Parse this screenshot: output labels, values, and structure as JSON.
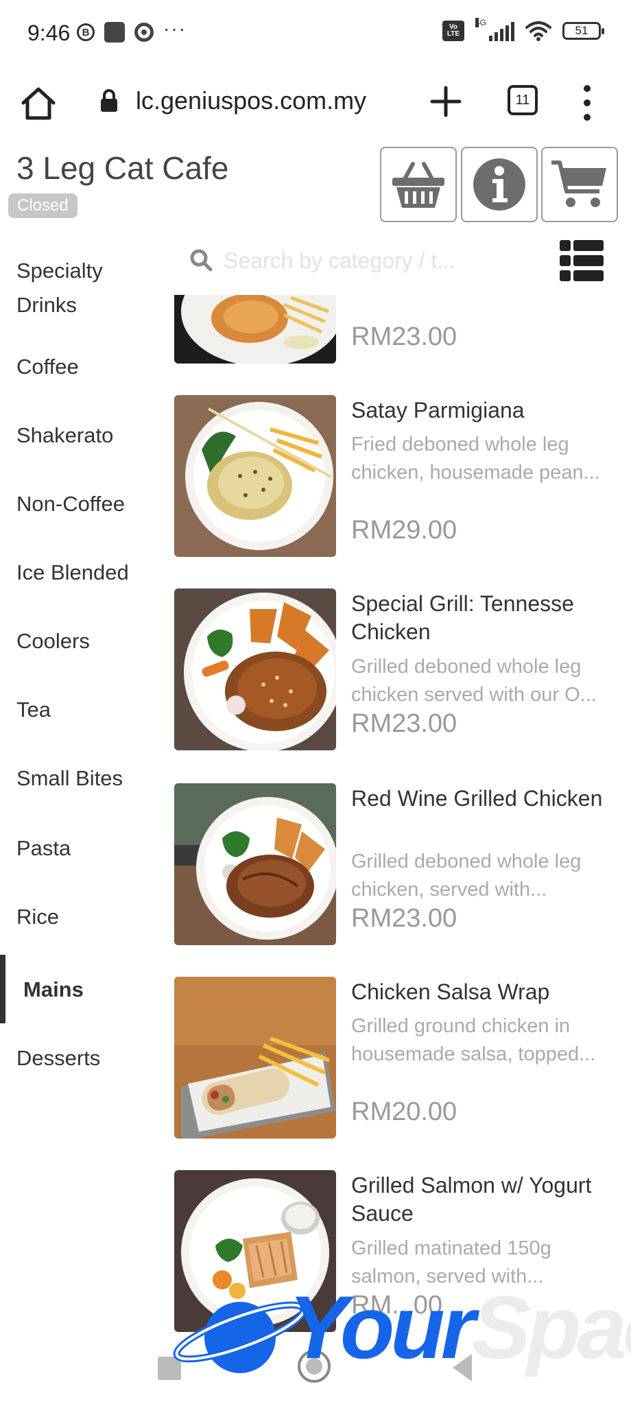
{
  "status_bar": {
    "time": "9:46",
    "b_icon_letter": "B",
    "more": "···",
    "volte": "Vo LTE",
    "network": "4G",
    "battery": "51"
  },
  "browser": {
    "url": "lc.geniuspos.com.my",
    "tab_count": "11"
  },
  "header": {
    "cafe_name": "3 Leg Cat Cafe",
    "status_badge": "Closed"
  },
  "search": {
    "placeholder": "Search by category / t..."
  },
  "sidebar": {
    "items": [
      {
        "label": "Specialty Drinks",
        "active": false
      },
      {
        "label": "Coffee",
        "active": false
      },
      {
        "label": "Shakerato",
        "active": false
      },
      {
        "label": "Non-Coffee",
        "active": false
      },
      {
        "label": "Ice Blended",
        "active": false
      },
      {
        "label": "Coolers",
        "active": false
      },
      {
        "label": "Tea",
        "active": false
      },
      {
        "label": "Small Bites",
        "active": false
      },
      {
        "label": "Pasta",
        "active": false
      },
      {
        "label": "Rice",
        "active": false
      },
      {
        "label": "Mains",
        "active": true
      },
      {
        "label": "Desserts",
        "active": false
      }
    ]
  },
  "products": [
    {
      "name": "",
      "desc1": "",
      "desc2": "",
      "price": "RM23.00"
    },
    {
      "name": "Satay Parmigiana",
      "desc1": "Fried deboned whole leg",
      "desc2": "chicken, housemade pean...",
      "price": "RM29.00"
    },
    {
      "name": "Special Grill: Tennesse Chicken",
      "desc1": "Grilled deboned whole leg",
      "desc2": "chicken served with our O...",
      "price": "RM23.00"
    },
    {
      "name": "Red Wine Grilled Chicken",
      "desc1": "Grilled deboned whole leg",
      "desc2": "chicken, served with...",
      "price": "RM23.00"
    },
    {
      "name": "Chicken Salsa Wrap",
      "desc1": "Grilled ground chicken in",
      "desc2": "housemade salsa, topped...",
      "price": "RM20.00"
    },
    {
      "name": "Grilled Salmon w/ Yogurt Sauce",
      "desc1": "Grilled matinated 150g",
      "desc2": "salmon, served with...",
      "price": "RM...00"
    }
  ],
  "watermark": {
    "text_a": "Your",
    "text_b": "Space"
  },
  "colors": {
    "badge_bg": "#c7c7c7",
    "price": "#999999",
    "desc": "#aaaaaa",
    "icon_gray": "#6d6d6d",
    "watermark_blue": "#1565e8"
  },
  "icons": {
    "basket": "basket-icon",
    "info": "info-icon",
    "cart": "cart-icon",
    "search": "search-icon",
    "list_view": "list-view-icon"
  }
}
